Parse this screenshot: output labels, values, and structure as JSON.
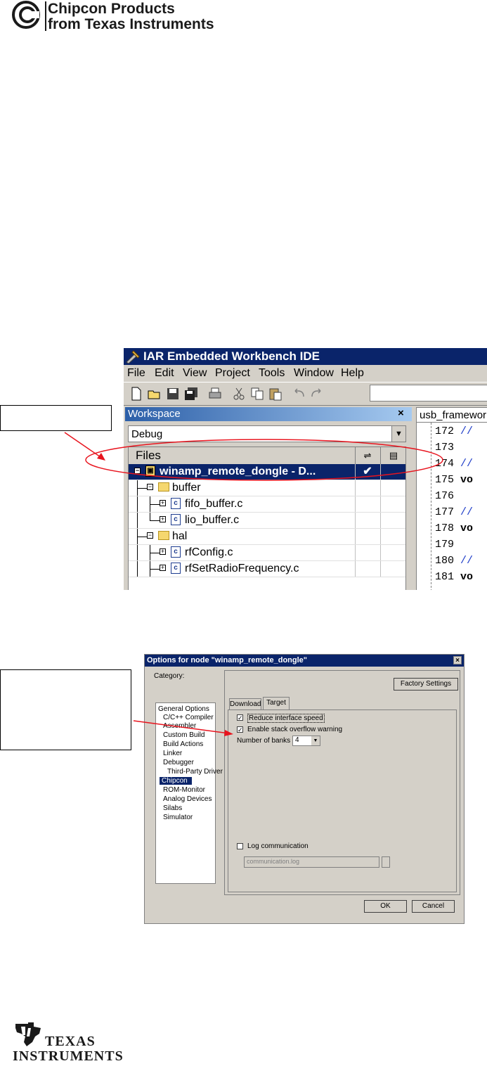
{
  "header": {
    "line1": "Chipcon Products",
    "line2": "from Texas Instruments"
  },
  "ide": {
    "title": "IAR Embedded Workbench IDE",
    "menu": [
      "File",
      "Edit",
      "View",
      "Project",
      "Tools",
      "Window",
      "Help"
    ],
    "workspace_label": "Workspace",
    "close_glyph": "×",
    "configuration": "Debug",
    "files_header": "Files",
    "tree": {
      "root": "winamp_remote_dongle - D...",
      "root_check": "✔",
      "folder_buffer": "buffer",
      "file_fifo": "fifo_buffer.c",
      "file_lio": "lio_buffer.c",
      "folder_hal": "hal",
      "file_rfconfig": "rfConfig.c",
      "file_rfset": "rfSetRadioFrequency.c"
    },
    "editor_tab": "usb_framework",
    "line_numbers": [
      "172",
      "173",
      "174",
      "175",
      "176",
      "177",
      "178",
      "179",
      "180",
      "181"
    ],
    "line_code": [
      "//",
      "",
      "//",
      "vo",
      "",
      "//",
      "vo",
      "",
      "//",
      "vo"
    ]
  },
  "dialog": {
    "title": "Options for node \"winamp_remote_dongle\"",
    "close_glyph": "×",
    "category_label": "Category:",
    "categories": [
      "General Options",
      "C/C++ Compiler",
      "Assembler",
      "Custom Build",
      "Build Actions",
      "Linker",
      "Debugger",
      "Third-Party Driver",
      "Chipcon",
      "ROM-Monitor",
      "Analog Devices",
      "Silabs",
      "Simulator"
    ],
    "factory_settings": "Factory Settings",
    "tab_download": "Download",
    "tab_target": "Target",
    "reduce_speed": "Reduce interface speed",
    "stack_warning": "Enable stack overflow warning",
    "banks_label": "Number of banks :",
    "banks_value": "4",
    "log_label": "Log communication",
    "log_file": "communication.log",
    "ok": "OK",
    "cancel": "Cancel"
  },
  "footer": {
    "line1": "TEXAS",
    "line2": "INSTRUMENTS"
  },
  "colors": {
    "title_bar": "#0a246a",
    "annotation": "#e8141e",
    "window_bg": "#d4d0c8"
  }
}
